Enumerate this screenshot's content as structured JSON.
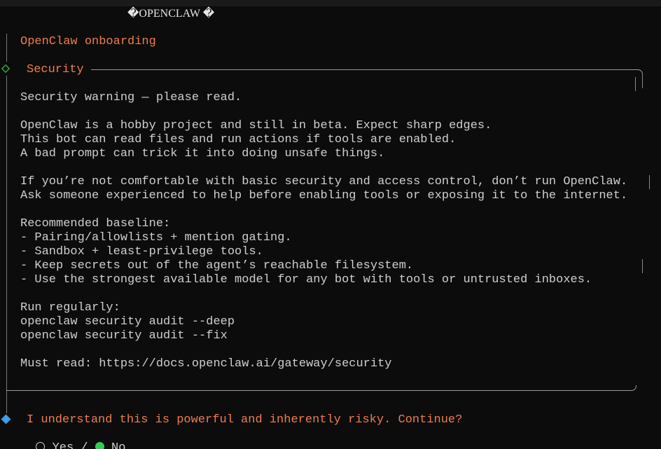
{
  "window": {
    "title": "�OPENCLAW �"
  },
  "header": {
    "label": "OpenClaw onboarding"
  },
  "section": {
    "title": "Security"
  },
  "content": {
    "lines": [
      "Security warning — please read.",
      "",
      "OpenClaw is a hobby project and still in beta. Expect sharp edges.",
      "This bot can read files and run actions if tools are enabled.",
      "A bad prompt can trick it into doing unsafe things.",
      "",
      "If you’re not comfortable with basic security and access control, don’t run OpenClaw.",
      "Ask someone experienced to help before enabling tools or exposing it to the internet.",
      "",
      "Recommended baseline:",
      "- Pairing/allowlists + mention gating.",
      "- Sandbox + least-privilege tools.",
      "- Keep secrets out of the agent’s reachable filesystem.",
      "- Use the strongest available model for any bot with tools or untrusted inboxes.",
      "",
      "Run regularly:",
      "openclaw security audit --deep",
      "openclaw security audit --fix",
      "",
      "Must read: https://docs.openclaw.ai/gateway/security"
    ]
  },
  "prompt": {
    "question": "I understand this is powerful and inherently risky. Continue?",
    "options": {
      "yes_label": "Yes",
      "separator": "/",
      "no_label": "No",
      "selected": "No"
    }
  },
  "icons": {
    "section_marker": "diamond-outline-icon",
    "prompt_marker": "diamond-filled-icon",
    "unselected": "radio-empty-icon",
    "selected": "radio-selected-icon"
  },
  "colors": {
    "background": "#0c0c0c",
    "accent_orange": "#f07c4c",
    "section_diamond": "#2fae3a",
    "prompt_diamond": "#3aa0e8",
    "selected_radio": "#2fcf55",
    "text": "#cccccc"
  }
}
